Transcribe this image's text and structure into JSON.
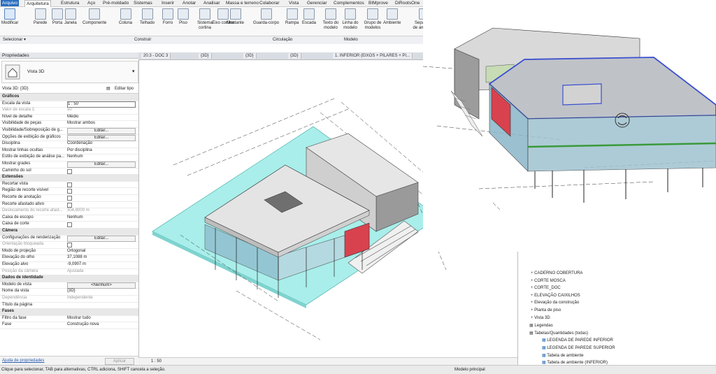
{
  "ribbon_tabs": [
    "Arquivo",
    "Arquitetura",
    "Estrutura",
    "Aço",
    "Pré-moldado",
    "Sistemas",
    "Inserir",
    "Anotar",
    "Analisar",
    "Massa e terreno",
    "Colaborar",
    "Vista",
    "Gerenciar",
    "Complementos",
    "BIMprove",
    "DiRootsOne",
    "EvolveLAB",
    "pyRe"
  ],
  "ribbon_tools": [
    "Modificar",
    "Parede",
    "Porta",
    "Janela",
    "Componente",
    "Coluna",
    "Telhado",
    "Forro",
    "Piso",
    "Sistema cortina",
    "Eixo cortina",
    "Montante",
    "Guarda-corpo",
    "Rampa",
    "Escada",
    "Texto do modelo",
    "Linha do modelo",
    "Grupo de modelos",
    "Ambiente",
    "Separador de ambiente",
    "Ide am"
  ],
  "ribbon_groups": [
    "Selecionar ▾",
    "Construir",
    "Circulação",
    "Modelo"
  ],
  "properties": {
    "title": "Propriedades",
    "type_name": "Vista 3D",
    "instance_label": "Vista 3D: {3D}",
    "edit_type": "Editar tipo",
    "rows": [
      {
        "k": "Gráficos",
        "sec": true
      },
      {
        "k": "Escala da vista",
        "v": "1 : 50"
      },
      {
        "k": "Valor de escala    1:",
        "v": "50",
        "dim": true
      },
      {
        "k": "Nível de detalhe",
        "v": "Médio"
      },
      {
        "k": "Visibilidade de peças",
        "v": "Mostrar ambos"
      },
      {
        "k": "Visibilidade/Sobreposição de g...",
        "v": "Editar...",
        "btn": true
      },
      {
        "k": "Opções de exibição de gráficos",
        "v": "Editar...",
        "btn": true
      },
      {
        "k": "Disciplina",
        "v": "Coordenação"
      },
      {
        "k": "Mostrar linhas ocultas",
        "v": "Por disciplina"
      },
      {
        "k": "Estilo de exibição de análise pa...",
        "v": "Nenhum"
      },
      {
        "k": "Mostrar grades",
        "v": "Editar...",
        "btn": true
      },
      {
        "k": "Caminho do sol",
        "chk": true
      },
      {
        "k": "Extensões",
        "sec": true
      },
      {
        "k": "Recortar vista",
        "chk": true
      },
      {
        "k": "Região de recorte visível",
        "chk": true
      },
      {
        "k": "Recorte de anotação",
        "chk": true
      },
      {
        "k": "Recorte afastado ativo",
        "chk": true
      },
      {
        "k": "Deslocamento do recorte afast...",
        "v": "304,8000 m",
        "dim": true
      },
      {
        "k": "Caixa de escopo",
        "v": "Nenhum"
      },
      {
        "k": "Caixa de corte",
        "chk": true
      },
      {
        "k": "Câmera",
        "sec": true
      },
      {
        "k": "Configurações de renderização",
        "v": "Editar...",
        "btn": true
      },
      {
        "k": "Orientação bloqueada",
        "chk": true,
        "dim": true
      },
      {
        "k": "Modo de projeção",
        "v": "Ortogonal"
      },
      {
        "k": "Elevação do olho",
        "v": "37,1088 m"
      },
      {
        "k": "Elevação alvo",
        "v": "-9,0907 m"
      },
      {
        "k": "Posição da câmera",
        "v": "Ajustada",
        "dim": true
      },
      {
        "k": "Dados de identidade",
        "sec": true
      },
      {
        "k": "Modelo de vista",
        "v": "<Nenhum>",
        "btn": true
      },
      {
        "k": "Nome da vista",
        "v": "{3D}"
      },
      {
        "k": "Dependência",
        "v": "Independente",
        "dim": true
      },
      {
        "k": "Título da página",
        "v": ""
      },
      {
        "k": "Fases",
        "sec": true
      },
      {
        "k": "Filtro da fase",
        "v": "Mostrar tudo"
      },
      {
        "k": "Fase",
        "v": "Construção nova"
      }
    ],
    "help_link": "Ajuda de propriedades",
    "apply": "Aplicar"
  },
  "view_tabs": [
    "20.3 - DOC 3",
    "{3D}",
    "{3D}",
    "{3D}",
    "1. INFERIOR (EIXOS + PILARES + PI..."
  ],
  "view_scale": "1 : 50",
  "browser_items": [
    {
      "t": "CADERNO COBERTURA",
      "lvl": 1
    },
    {
      "t": "CORTE MOSCA",
      "lvl": 1
    },
    {
      "t": "CORTE_DOC",
      "lvl": 1
    },
    {
      "t": "ELEVAÇÃO CAIXILHOS",
      "lvl": 1
    },
    {
      "t": "Elevação da construção",
      "lvl": 1
    },
    {
      "t": "Planta de piso",
      "lvl": 1
    },
    {
      "t": "Vista 3D",
      "lvl": 1
    },
    {
      "t": "Legendas",
      "lvl": 0
    },
    {
      "t": "Tabelas/Quantidades (todas)",
      "lvl": 0
    },
    {
      "t": "LEGENDA DE PAREDE INFERIOR",
      "lvl": 2
    },
    {
      "t": "LEGENDA DE PAREDE SUPERIOR",
      "lvl": 2
    },
    {
      "t": "Tabela de ambiente",
      "lvl": 2
    },
    {
      "t": "Tabela de ambiente (INFERIOR)",
      "lvl": 2
    }
  ],
  "status_text": "Clique para selecionar, TAB para alternativas, CTRL adiciona, SHIFT cancela a seleção.",
  "status_model": "Modelo principal",
  "colors": {
    "accent": "#2a6ebf",
    "terrain": "#a9eeea",
    "glass": "#8ab6c8",
    "red": "#d8424f",
    "highlight": "#3b4fd0",
    "green": "#3a9a3a"
  }
}
